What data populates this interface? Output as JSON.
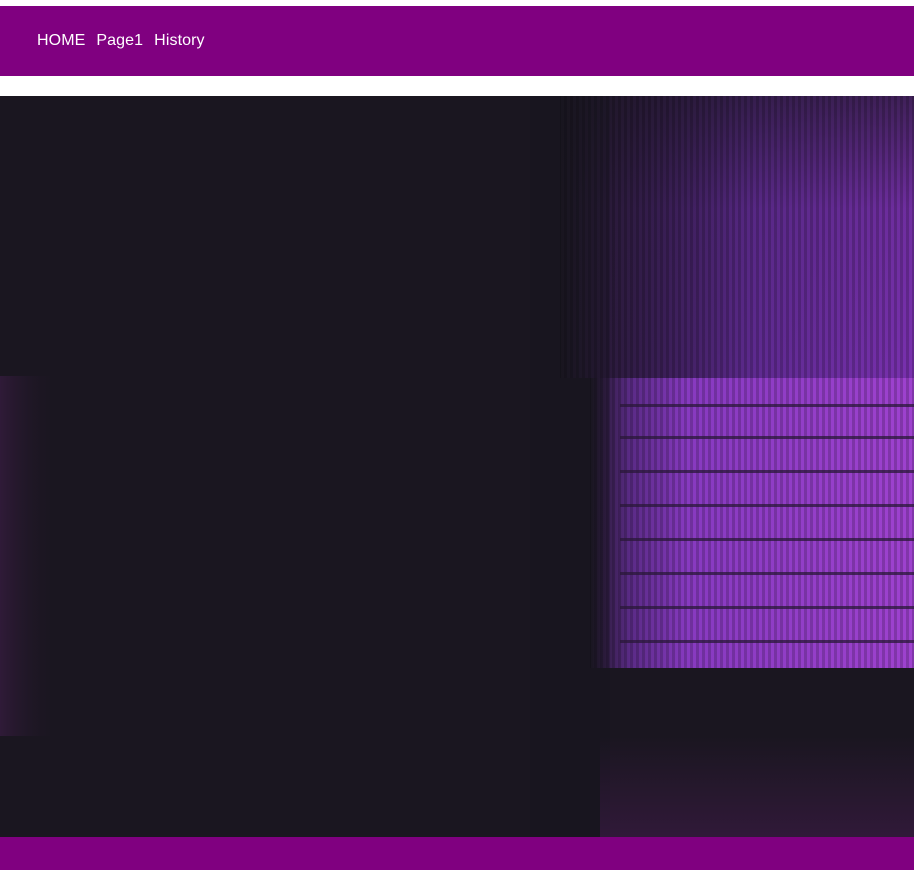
{
  "nav": {
    "items": [
      {
        "label": "HOME"
      },
      {
        "label": "Page1"
      },
      {
        "label": "History"
      }
    ]
  },
  "colors": {
    "header_bg": "#800080",
    "footer_bg": "#800080",
    "nav_text": "#ffffff",
    "hero_bg": "#1a1620",
    "hero_accent": "#9b3fd6"
  }
}
